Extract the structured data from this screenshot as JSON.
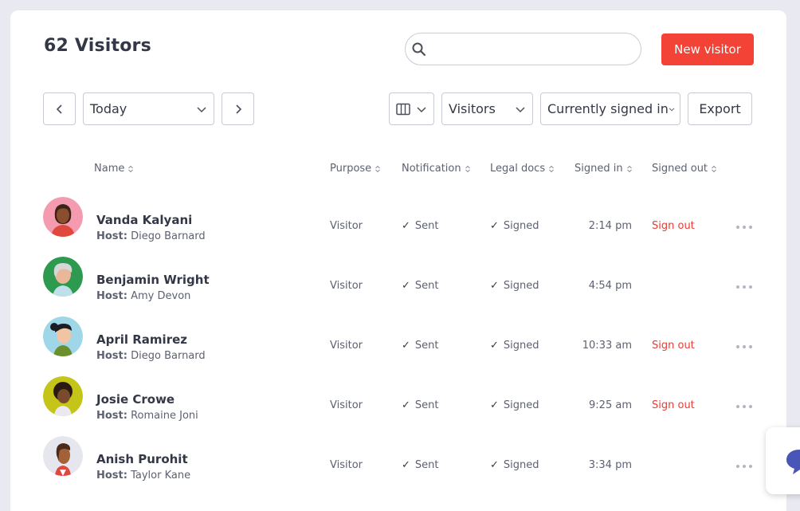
{
  "page_title": "62 Visitors",
  "search": {
    "placeholder": "",
    "value": ""
  },
  "new_visitor_label": "New visitor",
  "date_filter": {
    "value": "Today"
  },
  "type_filter": {
    "value": "Visitors"
  },
  "status_filter": {
    "value": "Currently signed in"
  },
  "export_label": "Export",
  "columns": [
    "Name",
    "Purpose",
    "Notification",
    "Legal docs",
    "Signed in",
    "Signed out"
  ],
  "host_prefix": "Host:",
  "rows": [
    {
      "name": "Vanda Kalyani",
      "host": "Diego Barnard",
      "purpose": "Visitor",
      "notification": "Sent",
      "legal": "Signed",
      "signed_in": "2:14 pm",
      "signed_out": "Sign out",
      "avatar_bg": "#f49bb0"
    },
    {
      "name": "Benjamin Wright",
      "host": "Amy Devon",
      "purpose": "Visitor",
      "notification": "Sent",
      "legal": "Signed",
      "signed_in": "4:54 pm",
      "signed_out": "",
      "avatar_bg": "#2e9a4f"
    },
    {
      "name": "April Ramirez",
      "host": "Diego Barnard",
      "purpose": "Visitor",
      "notification": "Sent",
      "legal": "Signed",
      "signed_in": "10:33 am",
      "signed_out": "Sign out",
      "avatar_bg": "#9fd6e8"
    },
    {
      "name": "Josie Crowe",
      "host": "Romaine Joni",
      "purpose": "Visitor",
      "notification": "Sent",
      "legal": "Signed",
      "signed_in": "9:25 am",
      "signed_out": "Sign out",
      "avatar_bg": "#c4c419"
    },
    {
      "name": "Anish Purohit",
      "host": "Taylor Kane",
      "purpose": "Visitor",
      "notification": "Sent",
      "legal": "Signed",
      "signed_in": "3:34 pm",
      "signed_out": "",
      "avatar_bg": "#e6e6ee"
    }
  ],
  "colors": {
    "accent": "#f24336",
    "sign_out": "#e63d36",
    "chat_icon": "#4a55b8"
  },
  "icons": {
    "search": "search-icon",
    "prev": "chevron-left-icon",
    "next": "chevron-right-icon",
    "columns": "columns-icon",
    "more": "more-dots-icon",
    "chat": "chat-bubble-icon"
  }
}
